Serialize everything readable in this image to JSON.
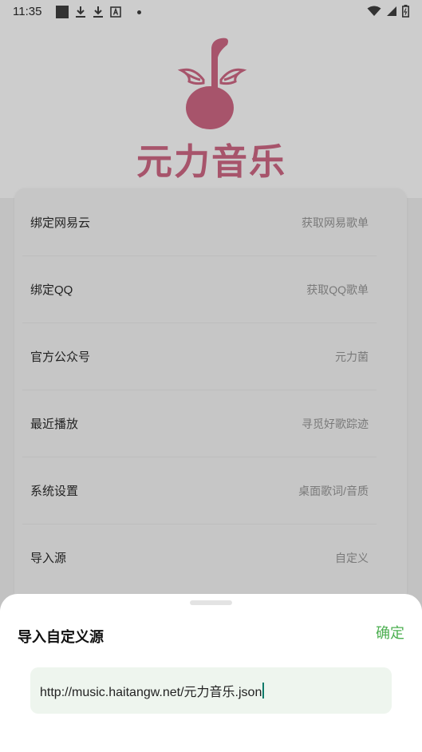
{
  "status_bar": {
    "time": "11:35",
    "left_icons": [
      "stop-square-icon",
      "download-icon",
      "download-icon",
      "font-icon",
      "dot-icon"
    ],
    "right_icons": [
      "wifi-icon",
      "signal-icon",
      "battery-icon"
    ]
  },
  "logo": {
    "text": "元力音乐",
    "color": "#a7546b"
  },
  "menu": {
    "items": [
      {
        "label": "绑定网易云",
        "hint": "获取网易歌单"
      },
      {
        "label": "绑定QQ",
        "hint": "获取QQ歌单"
      },
      {
        "label": "官方公众号",
        "hint": "元力菌"
      },
      {
        "label": "最近播放",
        "hint": "寻觅好歌踪迹"
      },
      {
        "label": "系统设置",
        "hint": "桌面歌词/音质"
      },
      {
        "label": "导入源",
        "hint": "自定义"
      }
    ]
  },
  "sheet": {
    "title": "导入自定义源",
    "confirm_label": "确定",
    "input_value": "http://music.haitangw.net/元力音乐.json",
    "accent_color": "#4caf50"
  }
}
